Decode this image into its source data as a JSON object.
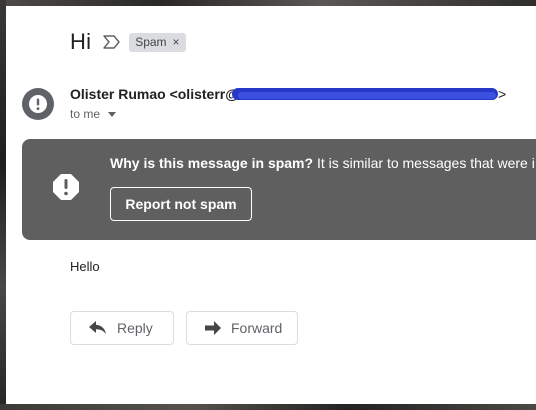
{
  "email": {
    "subject": "Hi",
    "label_chip": "Spam",
    "label_chip_close": "×",
    "sender_display": "Olister Rumao <olisterr@",
    "sender_suffix": ">",
    "recipient": "to me",
    "body": "Hello"
  },
  "spam_banner": {
    "question": "Why is this message in spam?",
    "explanation": " It is similar to messages that were i",
    "report_button": "Report not spam"
  },
  "actions": {
    "reply": "Reply",
    "forward": "Forward"
  },
  "icons": {
    "avatar": "warning-icon",
    "banner": "warning-octagon-icon",
    "importance": "importance-marker-icon",
    "reply": "reply-arrow-icon",
    "forward": "forward-arrow-icon"
  },
  "colors": {
    "banner_bg": "#5f5f5f",
    "redaction": "#2638c7",
    "chip_bg": "#dadce0"
  }
}
